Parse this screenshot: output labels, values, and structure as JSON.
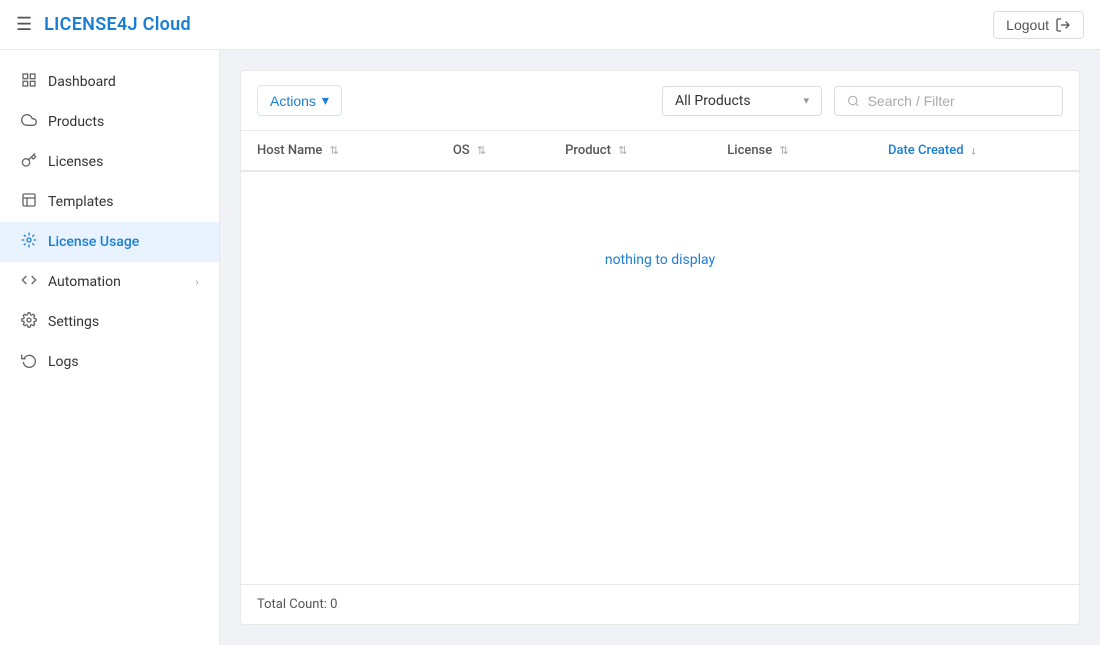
{
  "app": {
    "title": "LICENSE4J Cloud"
  },
  "header": {
    "logout_label": "Logout",
    "logout_icon": "→"
  },
  "sidebar": {
    "items": [
      {
        "id": "dashboard",
        "label": "Dashboard",
        "icon": "⌂",
        "active": false
      },
      {
        "id": "products",
        "label": "Products",
        "icon": "☁",
        "active": false
      },
      {
        "id": "licenses",
        "label": "Licenses",
        "icon": "🔑",
        "active": false
      },
      {
        "id": "templates",
        "label": "Templates",
        "icon": "☐",
        "active": false
      },
      {
        "id": "license-usage",
        "label": "License Usage",
        "icon": "⊙",
        "active": true
      },
      {
        "id": "automation",
        "label": "Automation",
        "icon": "</>",
        "active": false,
        "hasChevron": true
      },
      {
        "id": "settings",
        "label": "Settings",
        "icon": "⚙",
        "active": false
      },
      {
        "id": "logs",
        "label": "Logs",
        "icon": "⟳",
        "active": false
      }
    ]
  },
  "toolbar": {
    "actions_label": "Actions",
    "actions_arrow": "▾",
    "dropdown_selected": "All Products",
    "dropdown_arrow": "▾",
    "search_placeholder": "Search / Filter"
  },
  "table": {
    "columns": [
      {
        "id": "host_name",
        "label": "Host Name",
        "sort": "both",
        "active": false
      },
      {
        "id": "os",
        "label": "OS",
        "sort": "both",
        "active": false
      },
      {
        "id": "product",
        "label": "Product",
        "sort": "both",
        "active": false
      },
      {
        "id": "license",
        "label": "License",
        "sort": "both",
        "active": false
      },
      {
        "id": "date_created",
        "label": "Date Created",
        "sort": "desc",
        "active": true
      }
    ],
    "rows": [],
    "empty_message": "nothing to display"
  },
  "footer": {
    "total_count_label": "Total Count: 0"
  }
}
